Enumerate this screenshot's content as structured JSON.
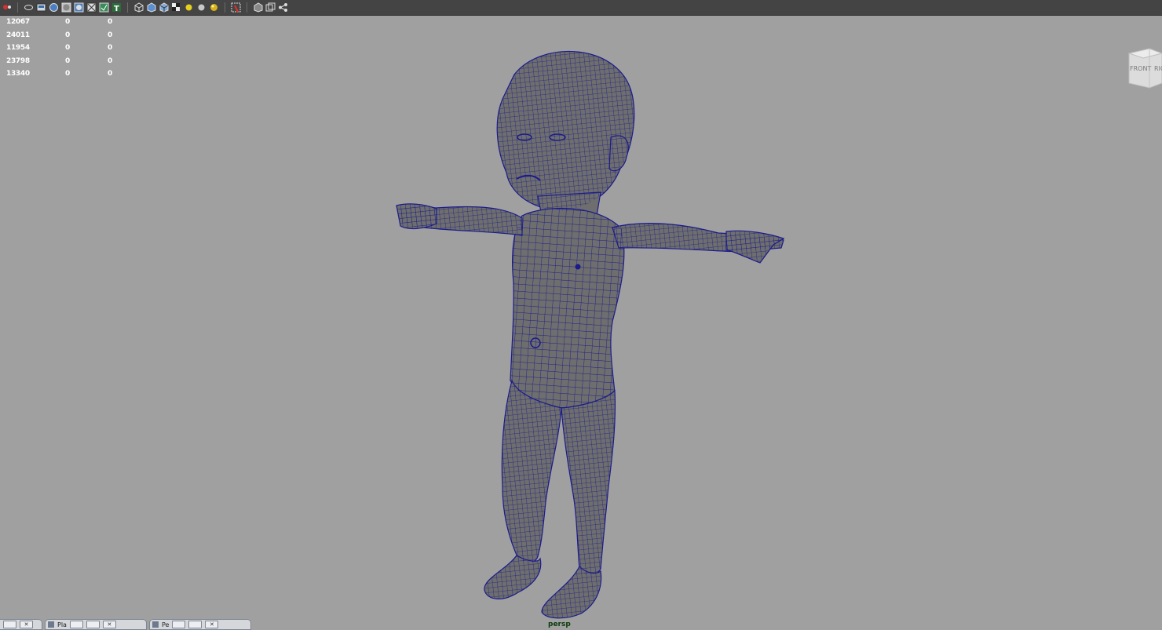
{
  "toolbar": {
    "icons": [
      "select-camera-icon",
      "bookmark-icon",
      "image-plane-icon",
      "wireframe-icon",
      "smooth-shade-icon",
      "textured-icon",
      "xray-icon",
      "isolate-icon",
      "text-icon",
      "cube-icon",
      "shaded-cube-icon",
      "wire-cube-icon",
      "checker-icon",
      "default-light-icon",
      "sphere-light-icon",
      "all-lights-icon",
      "grid-icon",
      "frame-icon",
      "multi-view-icon",
      "share-icon"
    ]
  },
  "hud": {
    "rows": [
      [
        "12067",
        "0",
        "0"
      ],
      [
        "24011",
        "0",
        "0"
      ],
      [
        "11954",
        "0",
        "0"
      ],
      [
        "23798",
        "0",
        "0"
      ],
      [
        "13340",
        "0",
        "0"
      ]
    ]
  },
  "view_cube": {
    "front_label": "FRONT",
    "right_label": "RIG"
  },
  "camera": {
    "name": "persp"
  },
  "bottom_tabs": [
    {
      "label": ""
    },
    {
      "label": "Pla"
    },
    {
      "label": "Pe"
    }
  ],
  "colors": {
    "viewport_bg": "#a0a0a0",
    "mesh_fill": "#6e6e6e",
    "wire": "#1b1b8c",
    "hud_text": "#ffffff"
  }
}
